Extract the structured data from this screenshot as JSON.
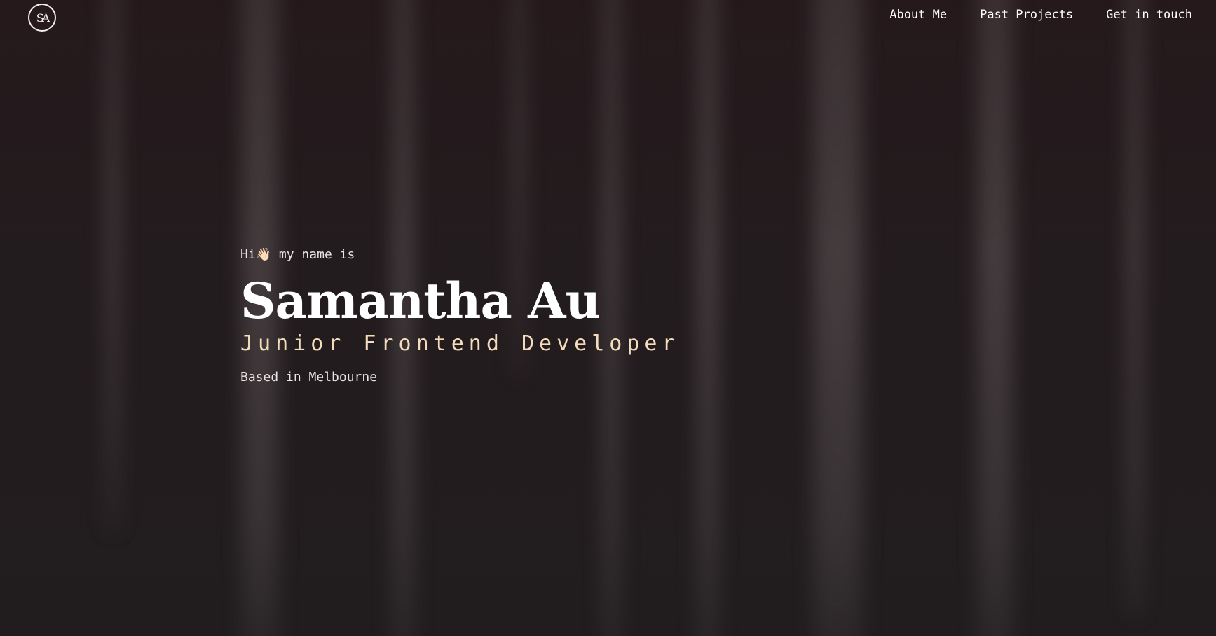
{
  "header": {
    "logo_text": "SA",
    "nav": [
      {
        "label": "About Me"
      },
      {
        "label": "Past Projects"
      },
      {
        "label": "Get in touch"
      }
    ]
  },
  "hero": {
    "greeting": "Hi👋🏻 my name is",
    "name": "Samantha Au",
    "role": "Junior Frontend Developer",
    "location": "Based in Melbourne"
  },
  "colors": {
    "background": "#221a1c",
    "text": "#ffffff",
    "accent": "#f6dcbc"
  }
}
